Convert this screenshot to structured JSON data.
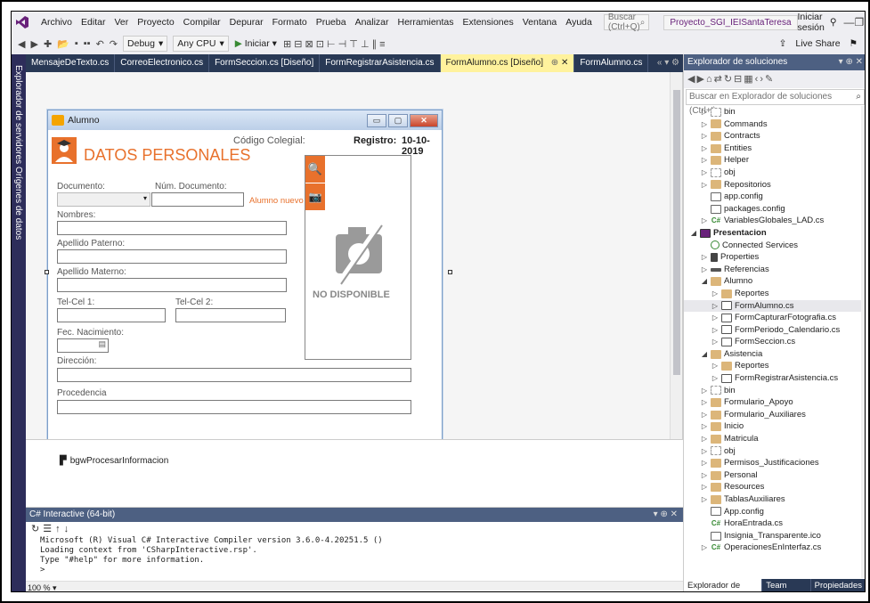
{
  "menu": {
    "items": [
      "Archivo",
      "Editar",
      "Ver",
      "Proyecto",
      "Compilar",
      "Depurar",
      "Formato",
      "Prueba",
      "Analizar",
      "Herramientas",
      "Extensiones",
      "Ventana",
      "Ayuda"
    ],
    "search_placeholder": "Buscar (Ctrl+Q)",
    "project_name": "Proyecto_SGI_IEISantaTeresa",
    "signin": "Iniciar sesión"
  },
  "toolbar": {
    "config": "Debug",
    "platform": "Any CPU",
    "start": "Iniciar",
    "live_share": "Live Share"
  },
  "side_strip": "Explorador de servidores   Orígenes de datos",
  "doc_tabs": [
    {
      "label": "MensajeDeTexto.cs",
      "active": false
    },
    {
      "label": "CorreoElectronico.cs",
      "active": false
    },
    {
      "label": "FormSeccion.cs [Diseño]",
      "active": false
    },
    {
      "label": "FormRegistrarAsistencia.cs",
      "active": false
    },
    {
      "label": "FormAlumno.cs [Diseño]",
      "active": true
    },
    {
      "label": "FormAlumno.cs",
      "active": false
    }
  ],
  "form": {
    "title": "Alumno",
    "codigo_label": "Código Colegial:",
    "registro_label": "Registro:",
    "registro_value": "10-10-2019",
    "header": "DATOS PERSONALES",
    "documento_label": "Documento:",
    "num_documento_label": "Núm. Documento:",
    "alumno_nuevo": "Alumno nuevo",
    "nombres_label": "Nombres:",
    "apellido_paterno_label": "Apellido Paterno:",
    "apellido_materno_label": "Apellido Materno:",
    "telcel1_label": "Tel-Cel 1:",
    "telcel2_label": "Tel-Cel 2:",
    "fec_nacimiento_label": "Fec. Nacimiento:",
    "direccion_label": "Dirección:",
    "procedencia_label": "Procedencia",
    "no_disponible": "NO DISPONIBLE"
  },
  "tray": {
    "component": "bgwProcesarInformacion"
  },
  "interactive": {
    "title": "C# Interactive (64-bit)",
    "lines": [
      "Microsoft (R) Visual C# Interactive Compiler version 3.6.0-4.20251.5 ()",
      "Loading context from 'CSharpInteractive.rsp'.",
      "Type \"#help\" for more information.",
      ">"
    ],
    "zoom": "100 %"
  },
  "solution_explorer": {
    "title": "Explorador de soluciones",
    "search_placeholder": "Buscar en Explorador de soluciones (Ctrl+')",
    "tabs": [
      "Explorador de soluciones",
      "Team Explorer",
      "Propiedades"
    ],
    "nodes": [
      {
        "indent": 1,
        "arrow": "▷",
        "icon": "ghost",
        "label": "bin"
      },
      {
        "indent": 1,
        "arrow": "▷",
        "icon": "folder",
        "label": "Commands"
      },
      {
        "indent": 1,
        "arrow": "▷",
        "icon": "folder",
        "label": "Contracts"
      },
      {
        "indent": 1,
        "arrow": "▷",
        "icon": "folder",
        "label": "Entities"
      },
      {
        "indent": 1,
        "arrow": "▷",
        "icon": "folder",
        "label": "Helper"
      },
      {
        "indent": 1,
        "arrow": "▷",
        "icon": "ghost",
        "label": "obj"
      },
      {
        "indent": 1,
        "arrow": "▷",
        "icon": "folder",
        "label": "Repositorios"
      },
      {
        "indent": 1,
        "arrow": "",
        "icon": "file",
        "label": "app.config"
      },
      {
        "indent": 1,
        "arrow": "",
        "icon": "file",
        "label": "packages.config"
      },
      {
        "indent": 1,
        "arrow": "▷",
        "icon": "cs",
        "label": "VariablesGlobales_LAD.cs"
      },
      {
        "indent": 0,
        "arrow": "◢",
        "icon": "proj",
        "label": "Presentacion",
        "bold": true
      },
      {
        "indent": 1,
        "arrow": "",
        "icon": "svc",
        "label": "Connected Services"
      },
      {
        "indent": 1,
        "arrow": "▷",
        "icon": "wrench",
        "label": "Properties"
      },
      {
        "indent": 1,
        "arrow": "▷",
        "icon": "ref",
        "label": "Referencias"
      },
      {
        "indent": 1,
        "arrow": "◢",
        "icon": "folder",
        "label": "Alumno"
      },
      {
        "indent": 2,
        "arrow": "▷",
        "icon": "folder",
        "label": "Reportes"
      },
      {
        "indent": 2,
        "arrow": "▷",
        "icon": "form",
        "label": "FormAlumno.cs",
        "selected": true
      },
      {
        "indent": 2,
        "arrow": "▷",
        "icon": "form",
        "label": "FormCapturarFotografia.cs"
      },
      {
        "indent": 2,
        "arrow": "▷",
        "icon": "form",
        "label": "FormPeriodo_Calendario.cs"
      },
      {
        "indent": 2,
        "arrow": "▷",
        "icon": "form",
        "label": "FormSeccion.cs"
      },
      {
        "indent": 1,
        "arrow": "◢",
        "icon": "folder",
        "label": "Asistencia"
      },
      {
        "indent": 2,
        "arrow": "▷",
        "icon": "folder",
        "label": "Reportes"
      },
      {
        "indent": 2,
        "arrow": "▷",
        "icon": "form",
        "label": "FormRegistrarAsistencia.cs"
      },
      {
        "indent": 1,
        "arrow": "▷",
        "icon": "ghost",
        "label": "bin"
      },
      {
        "indent": 1,
        "arrow": "▷",
        "icon": "folder",
        "label": "Formulario_Apoyo"
      },
      {
        "indent": 1,
        "arrow": "▷",
        "icon": "folder",
        "label": "Formulario_Auxiliares"
      },
      {
        "indent": 1,
        "arrow": "▷",
        "icon": "folder",
        "label": "Inicio"
      },
      {
        "indent": 1,
        "arrow": "▷",
        "icon": "folder",
        "label": "Matricula"
      },
      {
        "indent": 1,
        "arrow": "▷",
        "icon": "ghost",
        "label": "obj"
      },
      {
        "indent": 1,
        "arrow": "▷",
        "icon": "folder",
        "label": "Permisos_Justificaciones"
      },
      {
        "indent": 1,
        "arrow": "▷",
        "icon": "folder",
        "label": "Personal"
      },
      {
        "indent": 1,
        "arrow": "▷",
        "icon": "folder",
        "label": "Resources"
      },
      {
        "indent": 1,
        "arrow": "▷",
        "icon": "folder",
        "label": "TablasAuxiliares"
      },
      {
        "indent": 1,
        "arrow": "",
        "icon": "file",
        "label": "App.config"
      },
      {
        "indent": 1,
        "arrow": "",
        "icon": "cs",
        "label": "HoraEntrada.cs"
      },
      {
        "indent": 1,
        "arrow": "",
        "icon": "file",
        "label": "Insignia_Transparente.ico"
      },
      {
        "indent": 1,
        "arrow": "▷",
        "icon": "cs",
        "label": "OperacionesEnInterfaz.cs"
      }
    ]
  },
  "colors": {
    "accent": "#68217a",
    "tab_bar": "#293955",
    "active_tab": "#fff29d",
    "form_orange": "#e8712c"
  }
}
